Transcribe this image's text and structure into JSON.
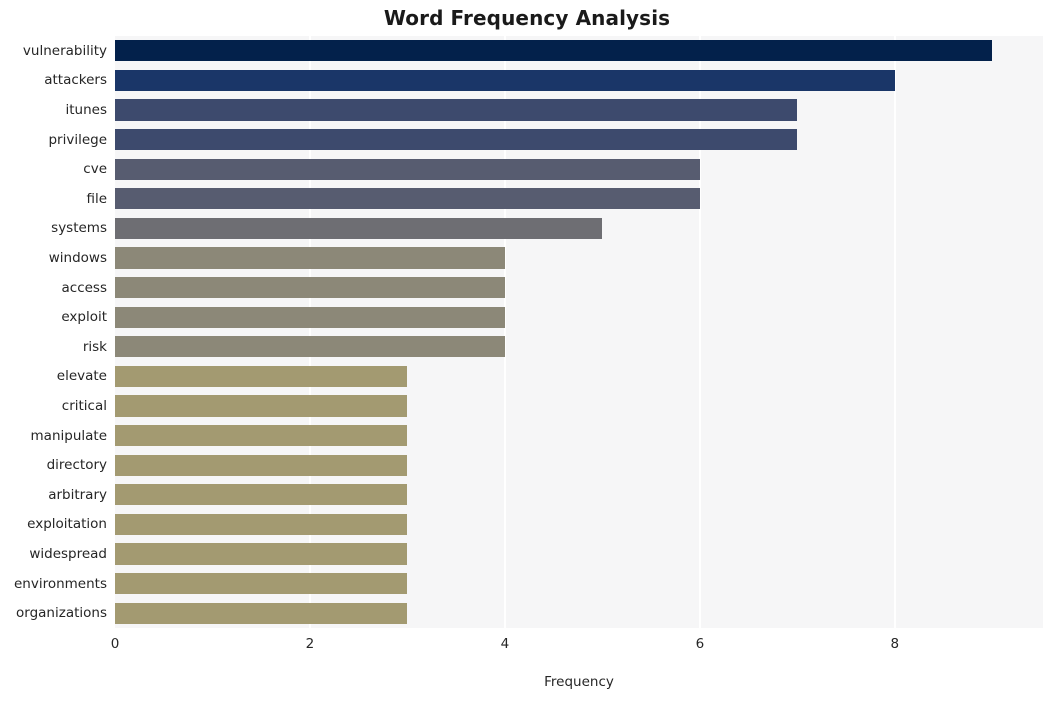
{
  "chart_data": {
    "type": "bar",
    "orientation": "horizontal",
    "title": "Word Frequency Analysis",
    "xlabel": "Frequency",
    "ylabel": "",
    "categories": [
      "vulnerability",
      "attackers",
      "itunes",
      "privilege",
      "cve",
      "file",
      "systems",
      "windows",
      "access",
      "exploit",
      "risk",
      "elevate",
      "critical",
      "manipulate",
      "directory",
      "arbitrary",
      "exploitation",
      "widespread",
      "environments",
      "organizations"
    ],
    "values": [
      9,
      8,
      7,
      7,
      6,
      6,
      5,
      4,
      4,
      4,
      4,
      3,
      3,
      3,
      3,
      3,
      3,
      3,
      3,
      3
    ],
    "bar_colors": [
      "#03214b",
      "#1a3668",
      "#3d4a6d",
      "#3d4a6d",
      "#575c70",
      "#575c70",
      "#6e6e73",
      "#8c8878",
      "#8c8878",
      "#8c8878",
      "#8c8878",
      "#a39a71",
      "#a39a71",
      "#a39a71",
      "#a39a71",
      "#a39a71",
      "#a39a71",
      "#a39a71",
      "#a39a71",
      "#a39a71"
    ],
    "xticks": [
      0,
      2,
      4,
      6,
      8
    ],
    "xtick_labels": [
      "0",
      "2",
      "4",
      "6",
      "8"
    ],
    "xlim": [
      0,
      9.52
    ],
    "grid": true,
    "grid_axis": "x",
    "grid_color": "#ffffff",
    "plot_background": "#f6f6f7",
    "figure_background": "#ffffff",
    "legend": null
  }
}
